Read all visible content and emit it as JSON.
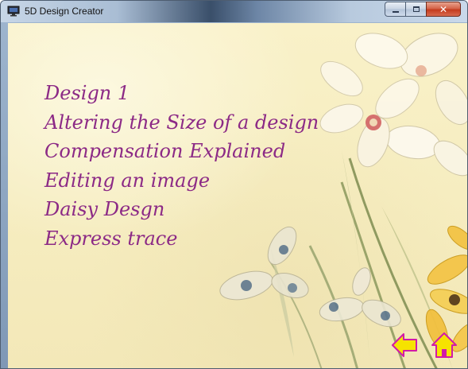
{
  "window": {
    "title": "5D Design Creator",
    "icon": "monitor-app-icon",
    "controls": [
      "minimize-icon",
      "maximize-icon",
      "close-icon"
    ]
  },
  "menu": {
    "items": [
      {
        "label": "Design 1"
      },
      {
        "label": "Altering the Size of a design"
      },
      {
        "label": "Compensation Explained"
      },
      {
        "label": "Editing an image"
      },
      {
        "label": "Daisy Desgn"
      },
      {
        "label": "Express trace"
      }
    ]
  },
  "navigation": {
    "back_icon": "back-arrow-icon",
    "home_icon": "home-icon"
  },
  "colors": {
    "menu_text": "#8c2a86",
    "background": "#f7eec3",
    "nav_fill": "#f6e300",
    "nav_stroke": "#d21aa8",
    "titlebar": "#a9bdd4",
    "close_button": "#c43b1d"
  }
}
